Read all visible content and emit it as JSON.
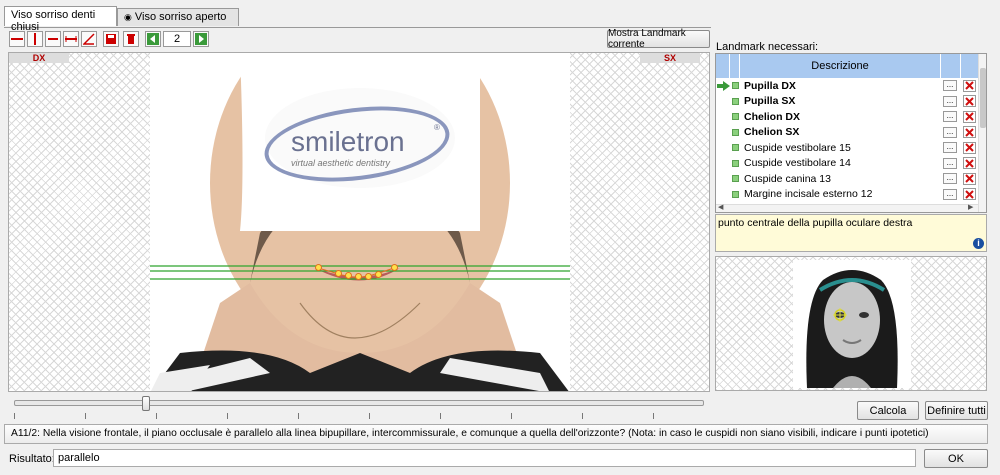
{
  "tabs": [
    {
      "label": "Viso sorriso denti chiusi"
    },
    {
      "label": "Viso sorriso aperto"
    }
  ],
  "toolbar": {
    "page_value": "2",
    "show_landmark_label": "Mostra Landmark corrente"
  },
  "image_panel": {
    "left_label": "DX",
    "right_label": "SX",
    "logo_text": "smiletron",
    "logo_sub": "virtual aesthetic dentistry"
  },
  "landmarks": {
    "heading": "Landmark necessari:",
    "column_header": "Descrizione",
    "items": [
      {
        "label": "Pupilla DX",
        "bold": true,
        "current": true
      },
      {
        "label": "Pupilla SX",
        "bold": true
      },
      {
        "label": "Chelion DX",
        "bold": true
      },
      {
        "label": "Chelion SX",
        "bold": true
      },
      {
        "label": "Cuspide vestibolare 15",
        "bold": false
      },
      {
        "label": "Cuspide vestibolare 14",
        "bold": false
      },
      {
        "label": "Cuspide canina 13",
        "bold": false
      },
      {
        "label": "Margine incisale esterno 12",
        "bold": false
      }
    ],
    "dots_label": "...",
    "description": "punto centrale della pupilla oculare destra"
  },
  "actions": {
    "calcola": "Calcola",
    "definire_tutti": "Definire tutti",
    "ok": "OK"
  },
  "question": "A11/2: Nella visione frontale, il piano occlusale è parallelo alla linea bipupillare, intercommissurale, e comunque a quella dell'orizzonte? (Nota: in caso le cuspidi non siano visibili, indicare i punti ipotetici)",
  "result": {
    "label": "Risultato:",
    "value": "parallelo"
  },
  "colors": {
    "accent_green": "#2fa52f",
    "header_blue": "#a9c9f0",
    "delete_red": "#d01010"
  }
}
